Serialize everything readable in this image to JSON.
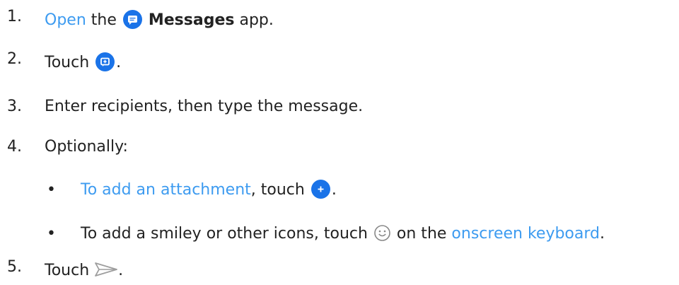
{
  "steps": [
    {
      "number": "1.",
      "link": "Open",
      "before_icon": " the ",
      "icon": "messages-app-icon",
      "bold": "Messages",
      "after": " app."
    },
    {
      "number": "2.",
      "before_icon": "Touch ",
      "icon": "start-chat-icon",
      "after": "."
    },
    {
      "number": "3.",
      "text": "Enter recipients, then type the message."
    },
    {
      "number": "4.",
      "text": "Optionally:",
      "bullets": [
        {
          "bullet": "•",
          "link": "To add an attachment",
          "before_icon": ", touch ",
          "icon": "add-attachment-icon",
          "after": "."
        },
        {
          "bullet": "•",
          "before_icon": "To add a smiley or other icons, touch ",
          "icon": "smiley-icon",
          "middle": " on the ",
          "link": "onscreen keyboard",
          "after": "."
        }
      ]
    },
    {
      "number": "5.",
      "before_icon": "Touch ",
      "icon": "send-icon",
      "after": "."
    }
  ],
  "colors": {
    "link": "#3d9bf0",
    "icon_blue": "#1a73e8",
    "text": "#222222"
  }
}
